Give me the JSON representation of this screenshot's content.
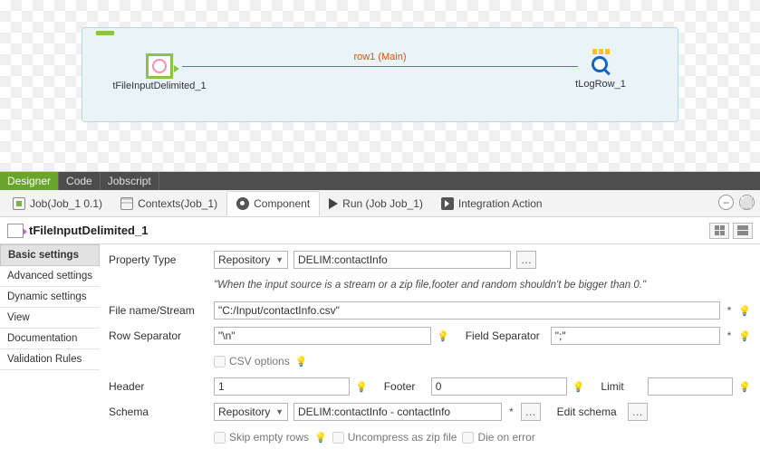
{
  "canvas": {
    "node_left": "tFileInputDelimited_1",
    "node_right": "tLogRow_1",
    "flow_label": "row1 (Main)"
  },
  "bottom_tabs": [
    "Designer",
    "Code",
    "Jobscript"
  ],
  "prop_tabs": {
    "job": "Job(Job_1 0.1)",
    "contexts": "Contexts(Job_1)",
    "component": "Component",
    "run": "Run (Job Job_1)",
    "integration": "Integration Action"
  },
  "component_title": "tFileInputDelimited_1",
  "side_nav": [
    "Basic settings",
    "Advanced settings",
    "Dynamic settings",
    "View",
    "Documentation",
    "Validation Rules"
  ],
  "form": {
    "property_type_label": "Property Type",
    "property_type_value": "Repository",
    "property_type_repo": "DELIM:contactInfo",
    "note": "\"When the input source is a stream or a zip file,footer and random shouldn't be bigger than 0.\"",
    "filename_label": "File name/Stream",
    "filename_value": "\"C:/Input/contactInfo.csv\"",
    "row_sep_label": "Row Separator",
    "row_sep_value": "\"\\n\"",
    "field_sep_label": "Field Separator",
    "field_sep_value": "\";\"",
    "csv_options": "CSV options",
    "header_label": "Header",
    "header_value": "1",
    "footer_label": "Footer",
    "footer_value": "0",
    "limit_label": "Limit",
    "limit_value": "",
    "schema_label": "Schema",
    "schema_select": "Repository",
    "schema_repo": "DELIM:contactInfo - contactInfo",
    "edit_schema": "Edit schema",
    "skip_empty": "Skip empty rows",
    "uncompress": "Uncompress as zip file",
    "die_on_error": "Die on error"
  }
}
